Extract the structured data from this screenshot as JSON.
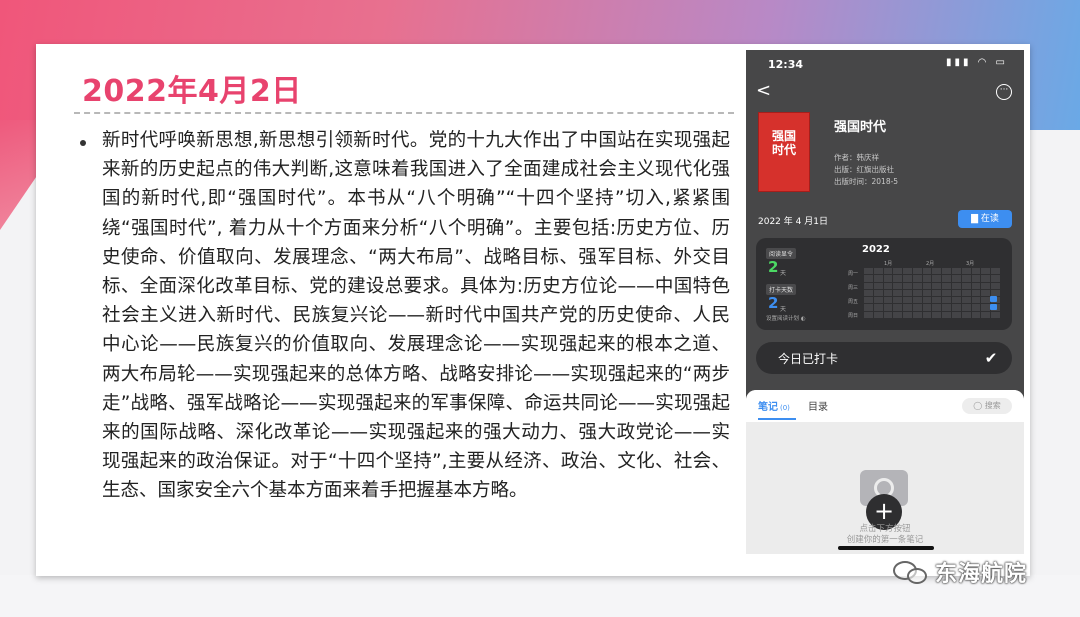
{
  "slide": {
    "title": "2022年4月2日",
    "body": "新时代呼唤新思想,新思想引领新时代。党的十九大作出了中国站在实现强起来新的历史起点的伟大判断,这意味着我国进入了全面建成社会主义现代化强国的新时代,即“强国时代”。本书从“八个明确”“十四个坚持”切入,紧紧围绕“强国时代”, 着力从十个方面来分析“八个明确”。主要包括:历史方位、历史使命、价值取向、发展理念、“两大布局”、战略目标、强军目标、外交目标、全面深化改革目标、党的建设总要求。具体为:历史方位论——中国特色社会主义进入新时代、民族复兴论——新时代中国共产党的历史使命、人民中心论——民族复兴的价值取向、发展理念论——实现强起来的根本之道、两大布局轮——实现强起来的总体方略、战略安排论——实现强起来的“两步走”战略、强军战略论——实现强起来的军事保障、命运共同论——实现强起来的国际战略、深化改革论——实现强起来的强大动力、强大政党论——实现强起来的政治保证。对于“十四个坚持”,主要从经济、政治、文化、社会、生态、国家安全六个基本方面来着手把握基本方略。"
  },
  "phone": {
    "status_time": "12:34",
    "status_icons": "▮▮▮ ◠ ▭",
    "back_glyph": "<",
    "more_glyph": "···",
    "book": {
      "cover_text_1": "强国",
      "cover_text_2": "时代",
      "title": "强国时代",
      "author": "作者：韩庆祥",
      "publisher": "出版：红旗出版社",
      "pub_date": "出版时间：2018-5"
    },
    "read_date": "2022 年 4 月1日",
    "read_button": "▇ 在读",
    "stats": {
      "streak_label": "阅读显令",
      "streak_value": "2",
      "streak_unit": "天",
      "checkin_label": "打卡天数",
      "checkin_value": "2",
      "checkin_unit": "天",
      "plan_link": "设置阅读计划 ◐",
      "year": "2022",
      "months": [
        "1月",
        "2月",
        "3月"
      ],
      "weekdays": [
        "周一",
        "周三",
        "周五",
        "周日"
      ]
    },
    "checkin_text": "今日已打卡",
    "notes": {
      "tab_notes": "笔记",
      "tab_notes_count": "(0)",
      "tab_toc": "目录",
      "search": "◯ 搜索",
      "add_glyph": "+",
      "hint_1": "点击下方按钮",
      "hint_2": "创建你的第一条笔记"
    }
  },
  "watermark": {
    "text": "东海航院"
  },
  "colors": {
    "title_pink": "#e8436e",
    "accent_blue": "#3d8ef0",
    "phone_bg": "#474748"
  }
}
